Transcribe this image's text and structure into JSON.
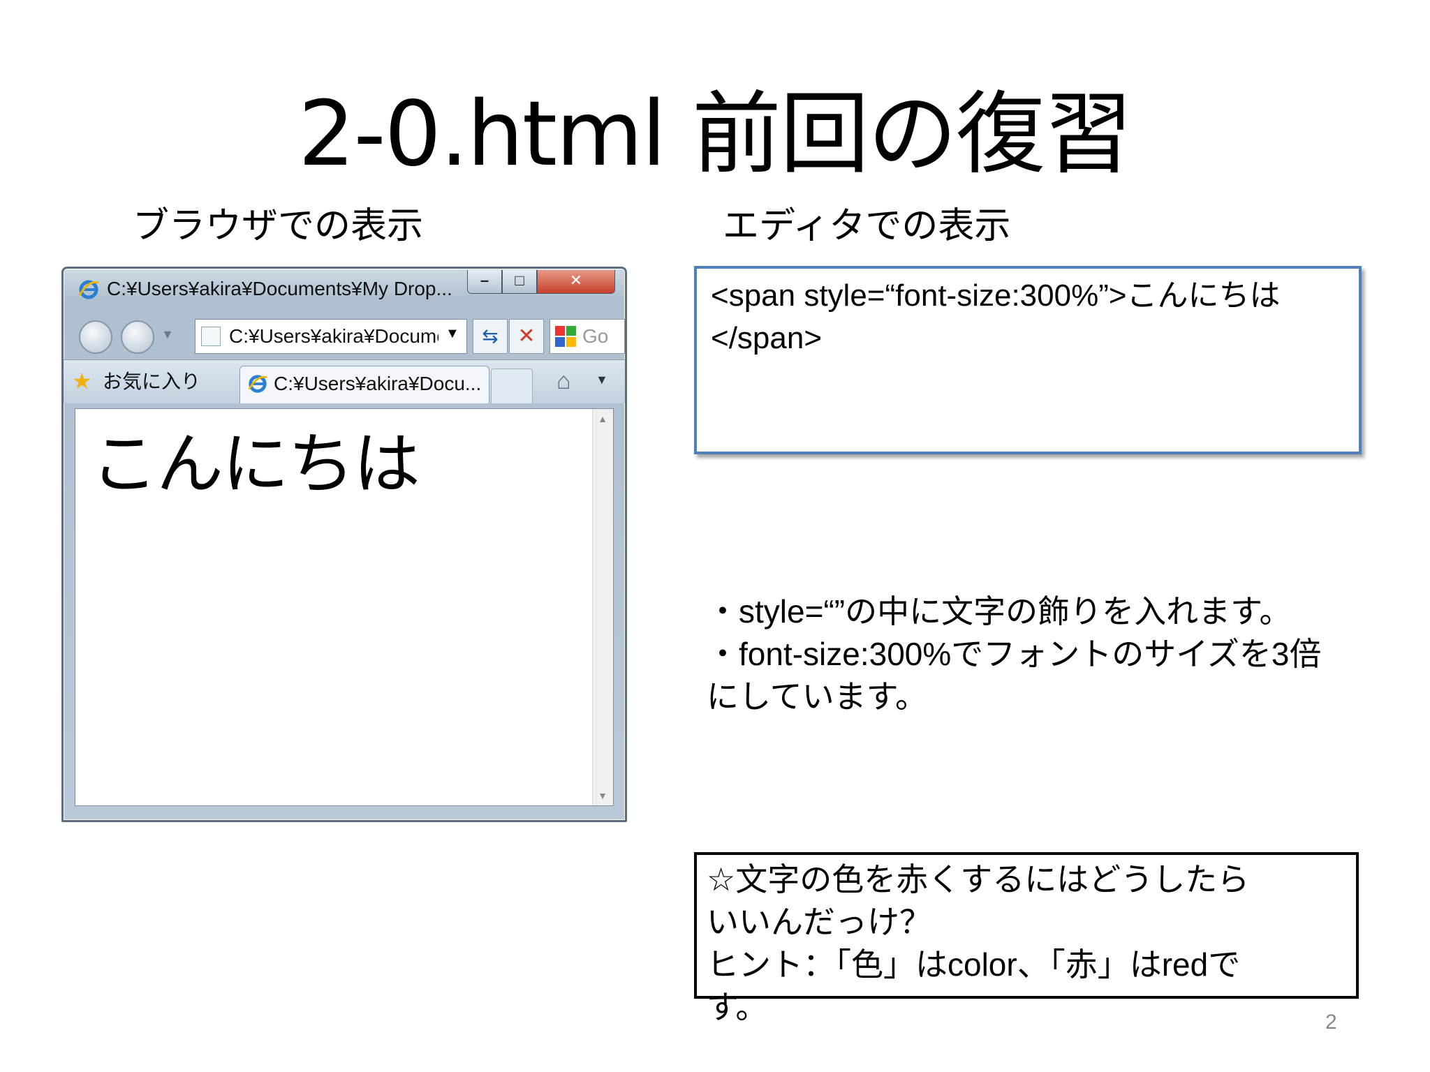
{
  "slide": {
    "title": "2-0.html 前回の復習",
    "browser_label": "ブラウザでの表示",
    "editor_label": "エディタでの表示",
    "page_number": "2"
  },
  "browser": {
    "window_title": "C:¥Users¥akira¥Documents¥My Drop...",
    "address": "C:¥Users¥akira¥Docume",
    "search_text": "Go",
    "favorites_label": "お気に入り",
    "tab_title": "C:¥Users¥akira¥Docu...",
    "content_text": "こんにちは"
  },
  "editor": {
    "code_line_1": "<span style=“font-size:300%”>こんにちは",
    "code_line_2": "</span>"
  },
  "notes": {
    "line_1": "・style=“”の中に文字の飾りを入れます。",
    "line_2": "・font-size:300%でフォントのサイズを3倍にしています。"
  },
  "question": {
    "line_1": "☆文字の色を赤くするにはどうしたら",
    "line_2": "いいんだっけ？",
    "line_3": "ヒント：「色」はcolor、「赤」はredで",
    "line_4": "す。"
  },
  "colors": {
    "editor_border": "#4f81bd",
    "close_button": "#c8402a"
  },
  "icons": [
    "ie-logo-icon",
    "star-icon",
    "home-icon",
    "refresh-icon",
    "stop-icon",
    "google-icon"
  ]
}
